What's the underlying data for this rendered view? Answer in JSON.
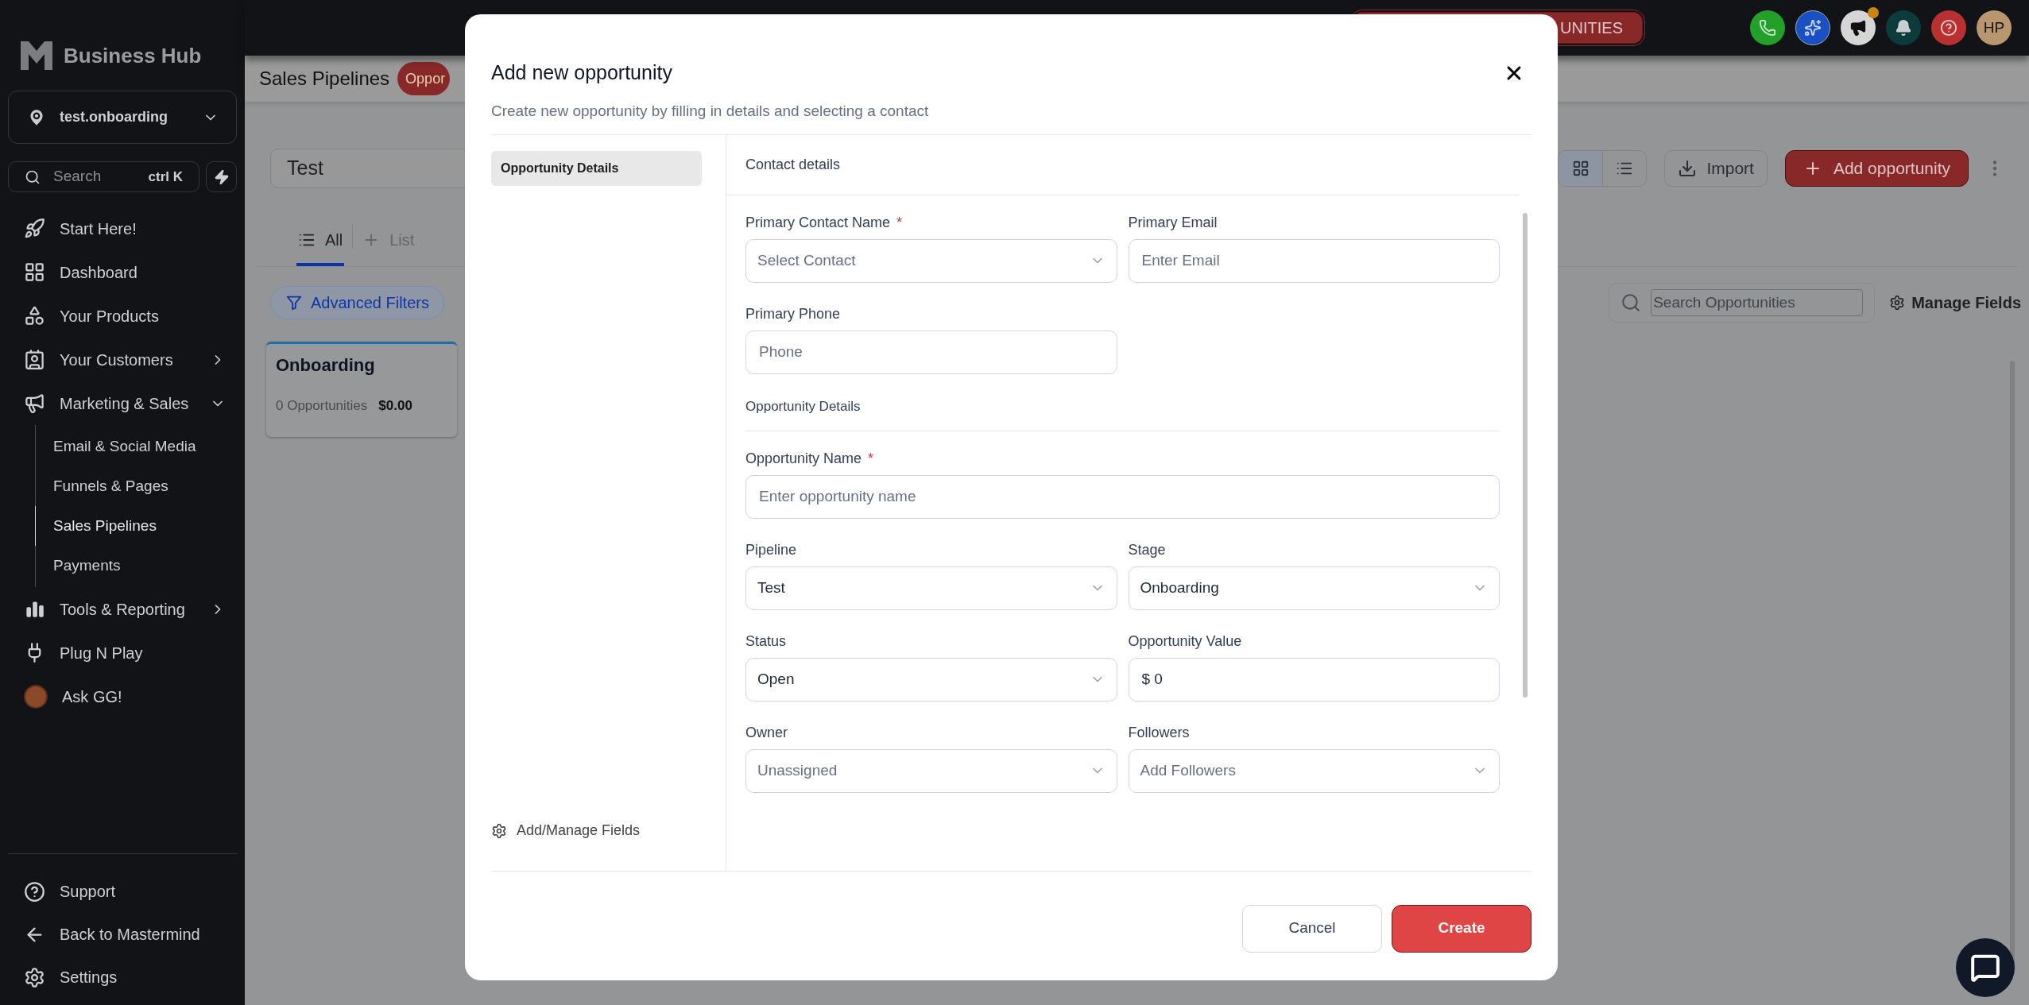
{
  "sidebar": {
    "brand": "Business Hub",
    "account": "test.onboarding",
    "search": {
      "placeholder": "Search",
      "shortcut": "ctrl K"
    },
    "items": [
      {
        "label": "Start Here!"
      },
      {
        "label": "Dashboard"
      },
      {
        "label": "Your Products"
      },
      {
        "label": "Your Customers",
        "expanded": false
      },
      {
        "label": "Marketing & Sales",
        "expanded": true,
        "children": [
          {
            "label": "Email & Social Media",
            "selected": false
          },
          {
            "label": "Funnels & Pages",
            "selected": false
          },
          {
            "label": "Sales Pipelines",
            "selected": true
          },
          {
            "label": "Payments",
            "selected": false
          }
        ]
      },
      {
        "label": "Tools & Reporting",
        "expanded": false
      },
      {
        "label": "Plug N Play"
      },
      {
        "label": "Ask GG!"
      }
    ],
    "footer": [
      {
        "label": "Support"
      },
      {
        "label": "Back to Mastermind"
      },
      {
        "label": "Settings"
      }
    ]
  },
  "top_bar": {
    "promo_button": "UNITIES",
    "announcements_badge": true,
    "avatar": "HP"
  },
  "page": {
    "title": "Sales Pipelines",
    "badge": "Oppor",
    "pipeline": "Test",
    "tabs": [
      {
        "label": "All",
        "selected": true
      },
      {
        "label": "List",
        "selected": false
      }
    ],
    "filter": "Advanced Filters",
    "view_modes": [
      {
        "selected": true
      },
      {
        "selected": false
      }
    ],
    "import": "Import",
    "add": "Add opportunity",
    "search": {
      "placeholder": "Search Opportunities"
    },
    "manage_fields": "Manage Fields",
    "columns": [
      {
        "title": "Onboarding",
        "count": "0 Opportunities",
        "value": "$0.00"
      }
    ]
  },
  "modal": {
    "title": "Add new opportunity",
    "subtitle": "Create new opportunity by filling in details and selecting a contact",
    "nav": [
      {
        "label": "Opportunity Details",
        "selected": true
      }
    ],
    "manage_fields": "Add/Manage Fields",
    "sections": [
      {
        "title": "Contact details",
        "kind": "bar",
        "rows": [
          [
            {
              "label": "Primary Contact Name",
              "required_mark": "*",
              "kind": "select",
              "placeholder": "Select Contact"
            },
            {
              "label": "Primary Email",
              "kind": "input",
              "placeholder": "Enter Email"
            }
          ],
          [
            {
              "label": "Primary Phone",
              "kind": "input",
              "placeholder": "Phone"
            }
          ]
        ]
      },
      {
        "title": "Opportunity Details",
        "kind": "sub",
        "rows": [
          [
            {
              "label": "Opportunity Name",
              "required_mark": "*",
              "kind": "input",
              "placeholder": "Enter opportunity name",
              "wide": true
            }
          ],
          [
            {
              "label": "Pipeline",
              "kind": "select",
              "value": "Test"
            },
            {
              "label": "Stage",
              "kind": "select",
              "value": "Onboarding"
            }
          ],
          [
            {
              "label": "Status",
              "kind": "select",
              "value": "Open"
            },
            {
              "label": "Opportunity Value",
              "kind": "input",
              "value": "$ 0"
            }
          ],
          [
            {
              "label": "Owner",
              "kind": "select",
              "placeholder": "Unassigned"
            },
            {
              "label": "Followers",
              "kind": "select",
              "placeholder": "Add Followers"
            }
          ]
        ]
      }
    ],
    "buttons": {
      "cancel": "Cancel",
      "create": "Create"
    }
  }
}
